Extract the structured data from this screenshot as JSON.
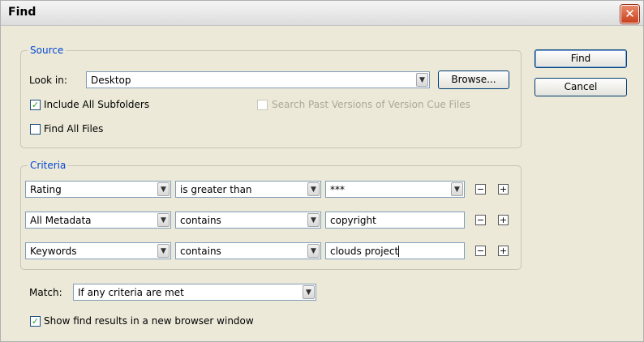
{
  "window": {
    "title": "Find",
    "close_glyph": "✕"
  },
  "source": {
    "legend": "Source",
    "look_in_label": "Look in:",
    "look_in_value": "Desktop",
    "browse_label": "Browse...",
    "include_subfolders": {
      "label": "Include All Subfolders",
      "checked": true
    },
    "search_past_versions": {
      "label": "Search Past Versions of Version Cue Files",
      "checked": false,
      "enabled": false
    },
    "find_all_files": {
      "label": "Find All Files",
      "checked": false
    }
  },
  "criteria": {
    "legend": "Criteria",
    "rows": [
      {
        "field": "Rating",
        "operator": "is greater than",
        "value": "***",
        "value_is_dropdown": true
      },
      {
        "field": "All Metadata",
        "operator": "contains",
        "value": "copyright",
        "value_is_dropdown": false
      },
      {
        "field": "Keywords",
        "operator": "contains",
        "value": "clouds project",
        "value_is_dropdown": false
      }
    ],
    "minus_glyph": "−",
    "plus_glyph": "+"
  },
  "match": {
    "label": "Match:",
    "value": "If any criteria are met"
  },
  "show_results": {
    "label": "Show find results in a new browser window",
    "checked": true
  },
  "buttons": {
    "find": "Find",
    "cancel": "Cancel"
  },
  "icons": {
    "dropdown_arrow": "▼",
    "check": "✓"
  },
  "colors": {
    "legend_text": "#0046d5",
    "close_button": "#c9401c",
    "check_mark": "#21a121"
  }
}
